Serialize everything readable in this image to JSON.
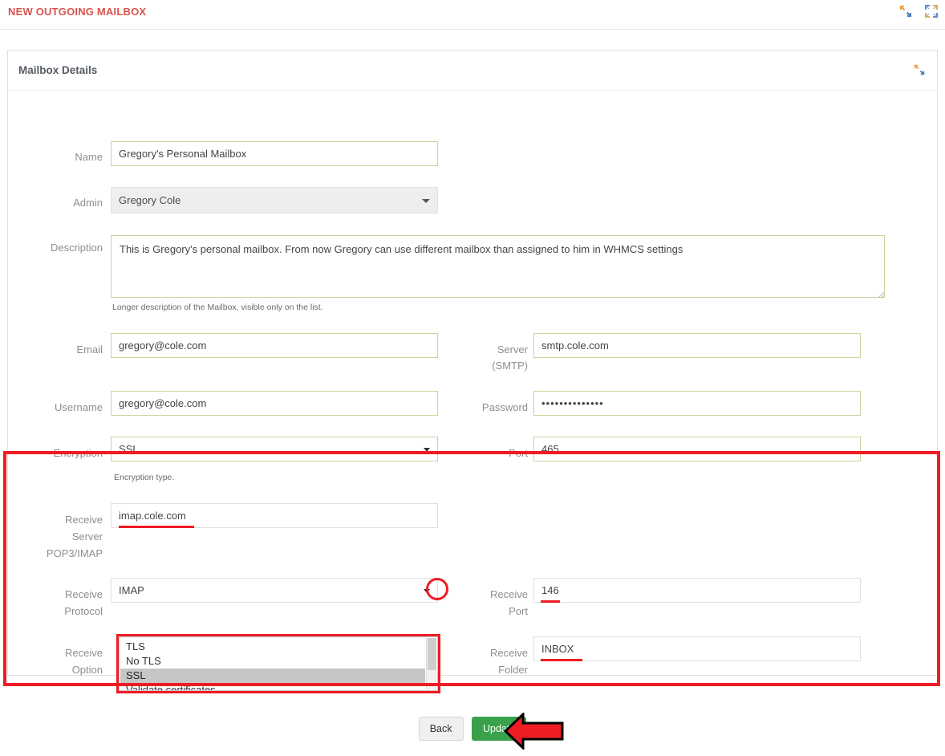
{
  "topbar": {
    "title": "NEW OUTGOING MAILBOX",
    "collapse_icon": "collapse-diagonal-icon",
    "expand_icon": "expand-fullscreen-icon"
  },
  "panel": {
    "title": "Mailbox Details",
    "collapse_icon": "collapse-diagonal-icon"
  },
  "form": {
    "name": {
      "label": "Name",
      "value": "Gregory's Personal Mailbox"
    },
    "admin": {
      "label": "Admin",
      "value": "Gregory Cole"
    },
    "description": {
      "label": "Description",
      "value": "This is Gregory's personal mailbox. From now Gregory can use different mailbox than assigned to him in WHMCS settings",
      "help": "Longer description of the Mailbox, visible only on the list."
    },
    "email": {
      "label": "Email",
      "value": "gregory@cole.com"
    },
    "server_smtp": {
      "label_line1": "Server",
      "label_line2": "(SMTP)",
      "value": "smtp.cole.com"
    },
    "username": {
      "label": "Username",
      "value": "gregory@cole.com"
    },
    "password": {
      "label": "Password",
      "value": "••••••••••••••"
    },
    "encryption": {
      "label": "Encryption",
      "value": "SSL",
      "help": "Encryption type."
    },
    "port": {
      "label": "Port",
      "value": "465"
    },
    "receive_server": {
      "label_line1": "Receive",
      "label_line2": "Server",
      "label_line3": "POP3/IMAP",
      "value": "imap.cole.com"
    },
    "receive_protocol": {
      "label_line1": "Receive",
      "label_line2": "Protocol",
      "value": "IMAP"
    },
    "receive_port": {
      "label_line1": "Receive",
      "label_line2": "Port",
      "value": "146"
    },
    "receive_option": {
      "label_line1": "Receive",
      "label_line2": "Option",
      "options": [
        {
          "label": "TLS",
          "selected": false
        },
        {
          "label": "No TLS",
          "selected": false
        },
        {
          "label": "SSL",
          "selected": true
        },
        {
          "label": "Validate certificates",
          "selected": false
        }
      ]
    },
    "receive_folder": {
      "label_line1": "Receive",
      "label_line2": "Folder",
      "value": "INBOX"
    }
  },
  "footer": {
    "back_label": "Back",
    "update_label": "Update"
  },
  "annotations": {
    "arrow_icon": "red-left-arrow-annotation",
    "highlight_color": "#ee1c25",
    "accent_color": "#d9534f",
    "update_button_color": "#3aa14a",
    "input_border_color": "#c3d69b"
  }
}
